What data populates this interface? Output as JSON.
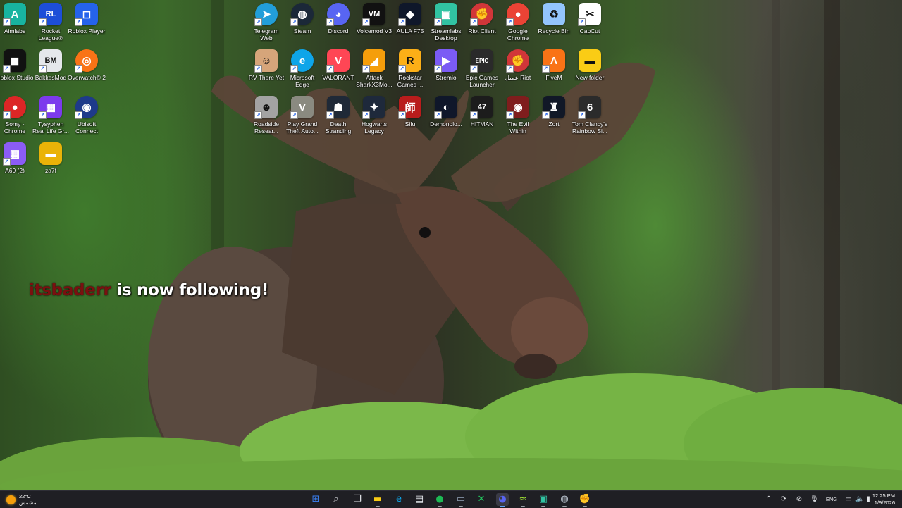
{
  "desktop": {
    "icons": [
      {
        "label": "Aimlabs",
        "color": "#18b4a0",
        "glyph": "A",
        "round": false
      },
      {
        "label": "Rocket League®",
        "color": "#1d4ed8",
        "glyph": "RL",
        "round": false
      },
      {
        "label": "Roblox Player",
        "color": "#2563eb",
        "glyph": "◻",
        "round": false
      },
      {
        "label": "Roblox Studio",
        "color": "#111111",
        "glyph": "◼",
        "round": false
      },
      {
        "label": "BakkesMod",
        "color": "#e5e7eb",
        "glyph": "BM",
        "round": false
      },
      {
        "label": "Overwatch® 2",
        "color": "#f97316",
        "glyph": "◎",
        "round": true
      },
      {
        "label": "Somy - Chrome",
        "color": "#dc2626",
        "glyph": "●",
        "round": true
      },
      {
        "label": "Tysyphen Real Life Gr...",
        "color": "#7c3aed",
        "glyph": "▦",
        "round": false
      },
      {
        "label": "Ubisoft Connect",
        "color": "#1e3a8a",
        "glyph": "◉",
        "round": true
      },
      {
        "label": "A69 (2)",
        "color": "#8b5cf6",
        "glyph": "▦",
        "round": false
      },
      {
        "label": "za7f",
        "color": "#eab308",
        "glyph": "▬",
        "round": false
      },
      {
        "label": "Telegram Web",
        "color": "#229ed9",
        "glyph": "➤",
        "round": true
      },
      {
        "label": "Steam",
        "color": "#1b2838",
        "glyph": "◍",
        "round": true
      },
      {
        "label": "Discord",
        "color": "#5865f2",
        "glyph": "◕",
        "round": true
      },
      {
        "label": "Voicemod V3",
        "color": "#111111",
        "glyph": "VM",
        "round": false
      },
      {
        "label": "AULA F75",
        "color": "#0f172a",
        "glyph": "◆",
        "round": false
      },
      {
        "label": "Streamlabs Desktop",
        "color": "#31c3a2",
        "glyph": "▣",
        "round": false
      },
      {
        "label": "Riot Client",
        "color": "#d13639",
        "glyph": "✊",
        "round": true
      },
      {
        "label": "Google Chrome",
        "color": "#ea4335",
        "glyph": "●",
        "round": true
      },
      {
        "label": "Recycle Bin",
        "color": "#93c5fd",
        "glyph": "♻",
        "round": false
      },
      {
        "label": "CapCut",
        "color": "#ffffff",
        "glyph": "✂",
        "round": false
      },
      {
        "label": "RV There Yet",
        "color": "#d6a57a",
        "glyph": "☺",
        "round": false
      },
      {
        "label": "Microsoft Edge",
        "color": "#0ea5e9",
        "glyph": "e",
        "round": true
      },
      {
        "label": "VALORANT",
        "color": "#ff4655",
        "glyph": "V",
        "round": false
      },
      {
        "label": "Attack SharkX3Mo...",
        "color": "#f59e0b",
        "glyph": "◢",
        "round": false
      },
      {
        "label": "Rockstar Games ...",
        "color": "#fcaf17",
        "glyph": "R",
        "round": false
      },
      {
        "label": "Stremio",
        "color": "#7b5bf5",
        "glyph": "▶",
        "round": false
      },
      {
        "label": "Epic Games Launcher",
        "color": "#2a2a2a",
        "glyph": "EPIC",
        "round": false
      },
      {
        "label": "عميل Riot",
        "color": "#d13639",
        "glyph": "✊",
        "round": true
      },
      {
        "label": "FiveM",
        "color": "#f97316",
        "glyph": "Λ",
        "round": false
      },
      {
        "label": "New folder",
        "color": "#facc15",
        "glyph": "▬",
        "round": false
      },
      {
        "label": "Roadside Resear...",
        "color": "#a3a3a3",
        "glyph": "☻",
        "round": false
      },
      {
        "label": "Play Grand Theft Auto...",
        "color": "#8a8a80",
        "glyph": "V",
        "round": false
      },
      {
        "label": "Death Stranding",
        "color": "#1f2937",
        "glyph": "☗",
        "round": false
      },
      {
        "label": "Hogwarts Legacy",
        "color": "#1e293b",
        "glyph": "✦",
        "round": false
      },
      {
        "label": "Sifu",
        "color": "#b91c1c",
        "glyph": "師",
        "round": false
      },
      {
        "label": "Demonolo...",
        "color": "#0f172a",
        "glyph": "◐",
        "round": false
      },
      {
        "label": "HITMAN",
        "color": "#1c1c1c",
        "glyph": "47",
        "round": false
      },
      {
        "label": "The Evil Within",
        "color": "#7f1d1d",
        "glyph": "◉",
        "round": false
      },
      {
        "label": "Zort",
        "color": "#111827",
        "glyph": "♜",
        "round": false
      },
      {
        "label": "Tom Clancy's Rainbow Si...",
        "color": "#2b2b2b",
        "glyph": "6",
        "round": false
      }
    ]
  },
  "notification": {
    "username": "itsbaderr",
    "message": " is now following!"
  },
  "taskbar": {
    "weather_temp": "22°C",
    "weather_desc": "مشمس",
    "apps": [
      {
        "name": "start-button",
        "glyph": "⊞",
        "color": "#3b82f6",
        "active": false,
        "running": false
      },
      {
        "name": "search-button",
        "glyph": "⌕",
        "color": "#e5e7eb",
        "active": false,
        "running": false
      },
      {
        "name": "task-view-button",
        "glyph": "❐",
        "color": "#e5e7eb",
        "active": false,
        "running": false
      },
      {
        "name": "file-explorer-button",
        "glyph": "▬",
        "color": "#facc15",
        "active": false,
        "running": true
      },
      {
        "name": "edge-button",
        "glyph": "e",
        "color": "#0ea5e9",
        "active": false,
        "running": false
      },
      {
        "name": "store-button",
        "glyph": "▤",
        "color": "#f1f5f9",
        "active": false,
        "running": false
      },
      {
        "name": "spotify-button",
        "glyph": "●",
        "color": "#1db954",
        "active": false,
        "running": true
      },
      {
        "name": "terminal-button",
        "glyph": "▭",
        "color": "#94a3b8",
        "active": false,
        "running": true
      },
      {
        "name": "xbox-button",
        "glyph": "✕",
        "color": "#22c55e",
        "active": false,
        "running": false
      },
      {
        "name": "discord-button",
        "glyph": "◕",
        "color": "#5865f2",
        "active": true,
        "running": true
      },
      {
        "name": "voicemod-button",
        "glyph": "≈",
        "color": "#a3e635",
        "active": false,
        "running": true
      },
      {
        "name": "streamlabs-button",
        "glyph": "▣",
        "color": "#31c3a2",
        "active": false,
        "running": true
      },
      {
        "name": "steam-button",
        "glyph": "◍",
        "color": "#cbd5e1",
        "active": false,
        "running": true
      },
      {
        "name": "riot-button",
        "glyph": "✊",
        "color": "#ef4444",
        "active": false,
        "running": true
      }
    ],
    "language": "ENG",
    "time": "12:25 PM",
    "date": "1/9/2026"
  }
}
